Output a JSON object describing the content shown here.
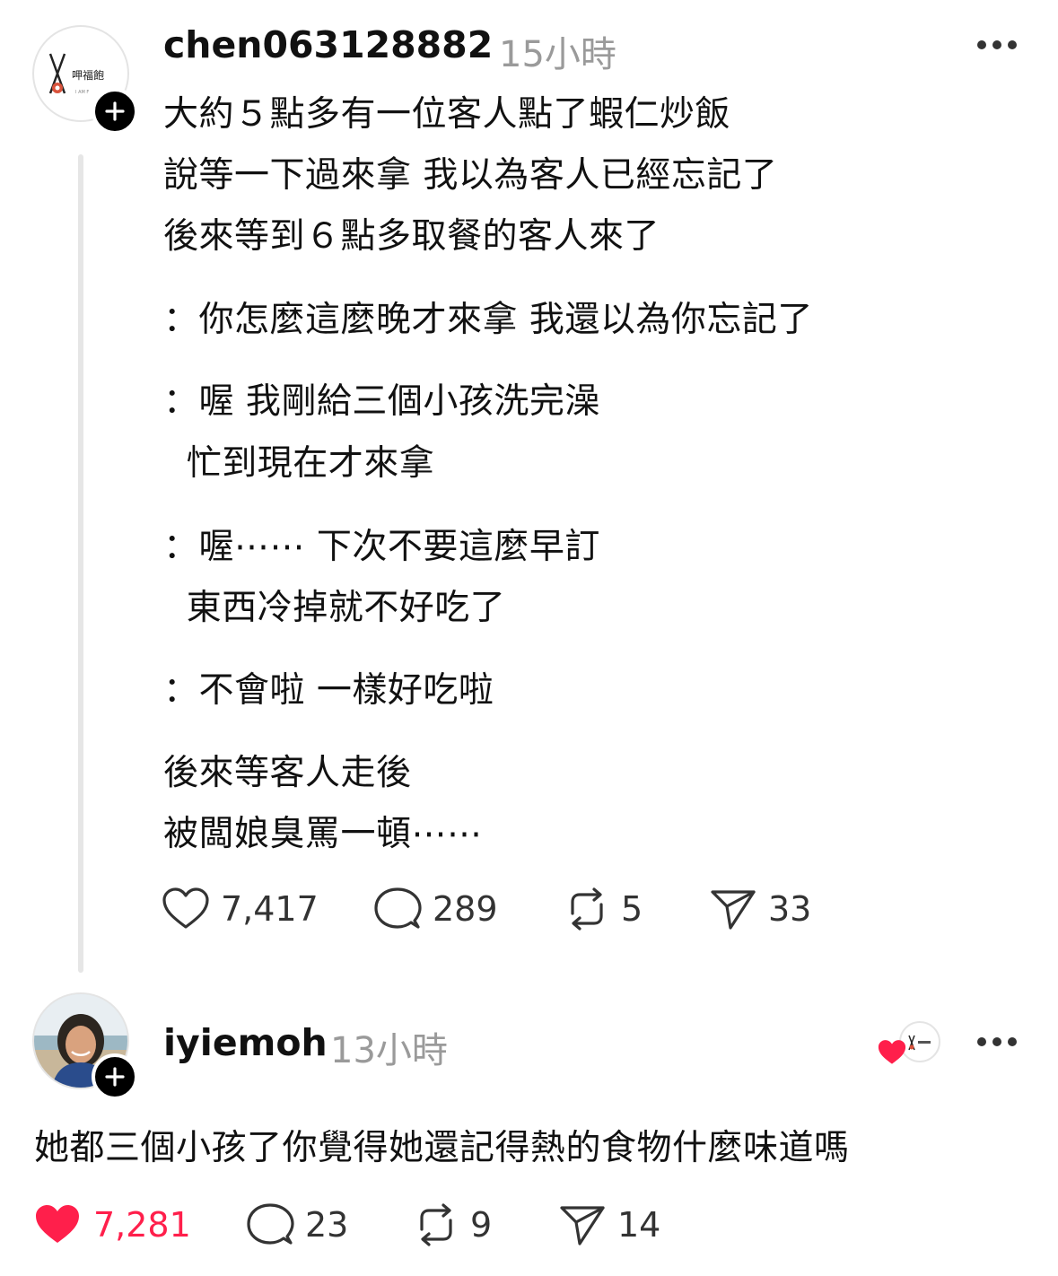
{
  "post": {
    "author": "chen063128882",
    "time": "15小時",
    "avatar_logo_text": "呷福飽",
    "avatar_logo_subtext": "I AM F",
    "lines": [
      "大約５點多有一位客人點了蝦仁炒飯",
      "說等一下過來拿 我以為客人已經忘記了",
      "後來等到６點多取餐的客人來了",
      "：你怎麼這麼晚才來拿 我還以為你忘記了",
      "：喔 我剛給三個小孩洗完澡",
      "  忙到現在才來拿",
      "：喔⋯⋯ 下次不要這麼早訂",
      "  東西冷掉就不好吃了",
      "：不會啦 一樣好吃啦",
      "後來等客人走後",
      "被闆娘臭罵一頓⋯⋯"
    ],
    "actions": {
      "likes": "7,417",
      "comments": "289",
      "reposts": "5",
      "shares": "33"
    }
  },
  "reply": {
    "author": "iyiemoh",
    "time": "13小時",
    "text": "她都三個小孩了你覺得她還記得熱的食物什麼味道嗎",
    "liked_by_author": true,
    "actions": {
      "likes": "7,281",
      "comments": "23",
      "reposts": "9",
      "shares": "14"
    }
  },
  "colors": {
    "like_active": "#ff1f4b",
    "secondary_text": "#9a9a9a",
    "icon": "#333333"
  },
  "icons": [
    "plus-icon",
    "more-icon",
    "heart-icon",
    "comment-icon",
    "repost-icon",
    "share-icon"
  ]
}
